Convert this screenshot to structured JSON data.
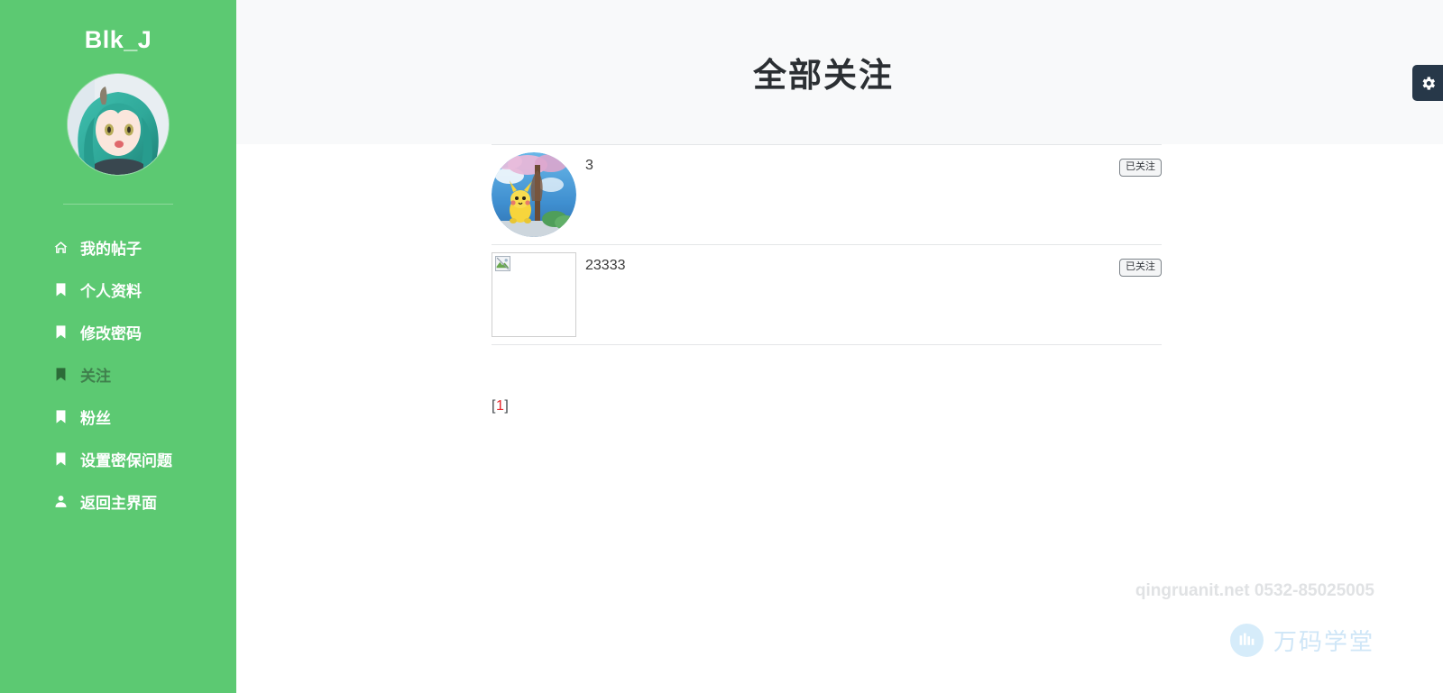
{
  "sidebar": {
    "brand": "Blk_J",
    "avatar_icon": "user-avatar-anime",
    "items": [
      {
        "label": "我的帖子",
        "icon": "home-icon",
        "active": false
      },
      {
        "label": "个人资料",
        "icon": "bookmark-icon",
        "active": false
      },
      {
        "label": "修改密码",
        "icon": "bookmark-icon",
        "active": false
      },
      {
        "label": "关注",
        "icon": "bookmark-icon",
        "active": true
      },
      {
        "label": "粉丝",
        "icon": "bookmark-icon",
        "active": false
      },
      {
        "label": "设置密保问题",
        "icon": "bookmark-icon",
        "active": false
      },
      {
        "label": "返回主界面",
        "icon": "user-icon",
        "active": false
      }
    ]
  },
  "header": {
    "title": "全部关注",
    "settings_icon": "gear-icon"
  },
  "follow_list": {
    "rows": [
      {
        "username": "3",
        "avatar_type": "image",
        "avatar_icon": "pikachu-sakura-avatar",
        "action_label": "已关注"
      },
      {
        "username": "23333",
        "avatar_type": "broken",
        "avatar_icon": "broken-image-icon",
        "action_label": "已关注"
      }
    ]
  },
  "pagination": {
    "bracket_open": "[",
    "current_page": "1",
    "bracket_close": "]"
  },
  "footer": {
    "contact": "qingruanit.net 0532-85025005",
    "logo_text": "万码学堂",
    "logo_icon": "wanma-logo-icon"
  },
  "colors": {
    "sidebar_green": "#5cc972",
    "active_text": "#3f7f4c",
    "active_icon": "#2c6b38",
    "header_bg": "#f8f9fa",
    "title_text": "#2b2f33",
    "gear_bg": "#273849",
    "page_current": "#e8262b",
    "footer_text": "#e0e2e4",
    "logo_blue": "#cfe6f7"
  }
}
